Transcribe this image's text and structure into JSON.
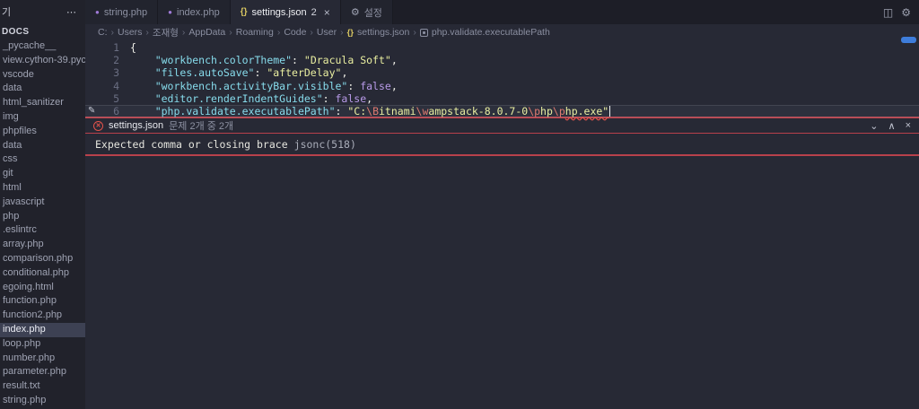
{
  "icons": {
    "php": "●",
    "json": "{}",
    "settings": "⚙",
    "more": "⋯",
    "split_editor": "◫",
    "gear": "⚙",
    "close": "×",
    "chevron_down": "⌄",
    "chevron_up": "∧",
    "pencil": "✎",
    "breadcrumb_sep": "›",
    "error_x": "✕"
  },
  "sidebar": {
    "header": "기",
    "section_label": "DOCS",
    "items": [
      {
        "label": "_pycache__"
      },
      {
        "label": "view.cython-39.pyc"
      },
      {
        "label": "vscode"
      },
      {
        "label": "data"
      },
      {
        "label": "html_sanitizer"
      },
      {
        "label": "img"
      },
      {
        "label": "phpfiles"
      },
      {
        "label": "data"
      },
      {
        "label": "css"
      },
      {
        "label": "git"
      },
      {
        "label": "html"
      },
      {
        "label": "javascript"
      },
      {
        "label": "php"
      },
      {
        "label": ".eslintrc"
      },
      {
        "label": "array.php"
      },
      {
        "label": "comparison.php"
      },
      {
        "label": "conditional.php"
      },
      {
        "label": "egoing.html"
      },
      {
        "label": "function.php"
      },
      {
        "label": "function2.php"
      },
      {
        "label": "index.php",
        "selected": true
      },
      {
        "label": "loop.php"
      },
      {
        "label": "number.php"
      },
      {
        "label": "parameter.php"
      },
      {
        "label": "result.txt"
      },
      {
        "label": "string.php"
      }
    ]
  },
  "tabs": [
    {
      "label": "string.php",
      "icon": "php",
      "active": false
    },
    {
      "label": "index.php",
      "icon": "php",
      "active": false
    },
    {
      "label": "settings.json",
      "icon": "json",
      "badge": "2",
      "active": true,
      "closable": true
    },
    {
      "label": "설정",
      "icon": "settings",
      "active": false
    }
  ],
  "breadcrumb": [
    {
      "label": "C:"
    },
    {
      "label": "Users"
    },
    {
      "label": "조재형"
    },
    {
      "label": "AppData"
    },
    {
      "label": "Roaming"
    },
    {
      "label": "Code"
    },
    {
      "label": "User"
    },
    {
      "label": "settings.json",
      "icon": "json"
    },
    {
      "label": "php.validate.executablePath",
      "icon": "symbol"
    }
  ],
  "editor": {
    "lines": [
      {
        "num": "1",
        "tokens": [
          [
            "p",
            "{"
          ]
        ]
      },
      {
        "num": "2",
        "tokens": [
          [
            "p",
            "    "
          ],
          [
            "k",
            "\"workbench.colorTheme\""
          ],
          [
            "p",
            ": "
          ],
          [
            "s",
            "\"Dracula Soft\""
          ],
          [
            "p",
            ","
          ]
        ]
      },
      {
        "num": "3",
        "tokens": [
          [
            "p",
            "    "
          ],
          [
            "k",
            "\"files.autoSave\""
          ],
          [
            "p",
            ": "
          ],
          [
            "s",
            "\"afterDelay\""
          ],
          [
            "p",
            ","
          ]
        ]
      },
      {
        "num": "4",
        "tokens": [
          [
            "p",
            "    "
          ],
          [
            "k",
            "\"workbench.activityBar.visible\""
          ],
          [
            "p",
            ": "
          ],
          [
            "w",
            "false"
          ],
          [
            "p",
            ","
          ]
        ]
      },
      {
        "num": "5",
        "tokens": [
          [
            "p",
            "    "
          ],
          [
            "k",
            "\"editor.renderIndentGuides\""
          ],
          [
            "p",
            ": "
          ],
          [
            "w",
            "false"
          ],
          [
            "p",
            ","
          ]
        ]
      },
      {
        "num": "6",
        "active": true,
        "pencil": true,
        "caret": true,
        "tokens": [
          [
            "p",
            "    "
          ],
          [
            "k",
            "\"php.validate.executablePath\""
          ],
          [
            "p",
            ": "
          ],
          [
            "s",
            "\"C:"
          ],
          [
            "e",
            "\\B"
          ],
          [
            "s",
            "itnami"
          ],
          [
            "e",
            "\\w"
          ],
          [
            "s",
            "ampstack-8.0.7-0"
          ],
          [
            "e",
            "\\p"
          ],
          [
            "s",
            "hp"
          ],
          [
            "e",
            "\\p"
          ],
          [
            "serr",
            "hp.exe\""
          ]
        ]
      }
    ]
  },
  "problems": {
    "panel_title": "settings.json",
    "count_label": "문제 2개 중 2개",
    "error": {
      "message": "Expected comma or closing brace",
      "source": "jsonc(518)"
    }
  }
}
